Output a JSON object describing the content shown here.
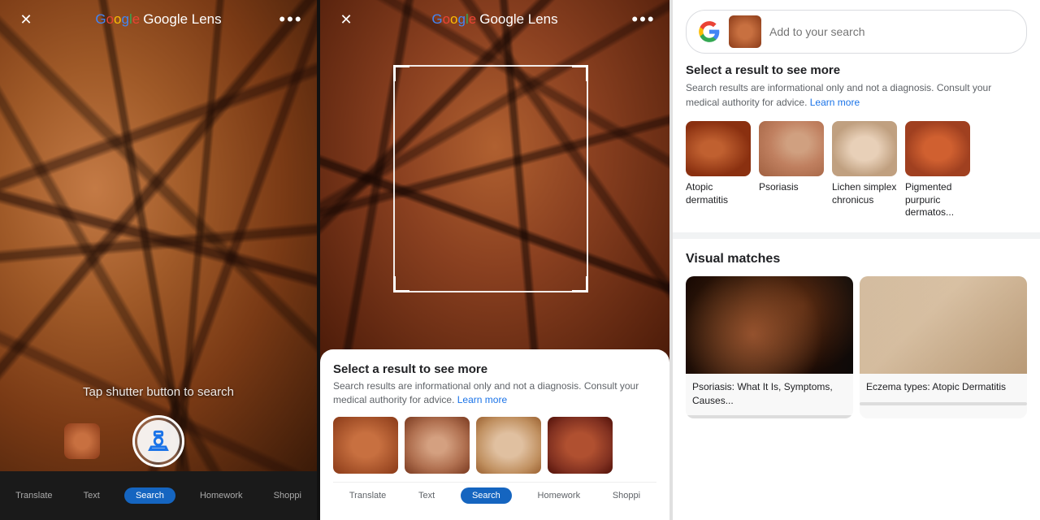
{
  "panel1": {
    "title": "Google Lens",
    "tap_hint": "Tap shutter button to search",
    "tabs": [
      {
        "label": "Translate",
        "active": false
      },
      {
        "label": "Text",
        "active": false
      },
      {
        "label": "Search",
        "active": true
      },
      {
        "label": "Homework",
        "active": false
      },
      {
        "label": "Shoppi",
        "active": false
      }
    ]
  },
  "panel2": {
    "title": "Google Lens",
    "bottom_sheet": {
      "title": "Select a result to see more",
      "desc": "Search results are informational only and not a diagnosis. Consult your medical authority for advice.",
      "learn_more": "Learn more"
    },
    "tabs": [
      {
        "label": "Translate",
        "active": false
      },
      {
        "label": "Text",
        "active": false
      },
      {
        "label": "Search",
        "active": true
      },
      {
        "label": "Homework",
        "active": false
      },
      {
        "label": "Shoppi",
        "active": false
      }
    ]
  },
  "panel3": {
    "search_placeholder": "Add to your search",
    "select_section": {
      "title": "Select a result to see more",
      "desc": "Search results are informational only and not a diagnosis. Consult your medical authority for advice.",
      "learn_more": "Learn more"
    },
    "conditions": [
      {
        "label": "Atopic dermatitis"
      },
      {
        "label": "Psoriasis"
      },
      {
        "label": "Lichen simplex chronicus"
      },
      {
        "label": "Pigmented purpuric dermatos..."
      }
    ],
    "visual_matches": {
      "title": "Visual matches",
      "items": [
        {
          "caption": "Psoriasis: What It Is, Symptoms, Causes..."
        },
        {
          "caption": "Eczema types: Atopic Dermatitis"
        }
      ]
    }
  },
  "icons": {
    "close": "✕",
    "flash_off": "⚡",
    "more": "⋯",
    "search_circle": "🔍",
    "gallery": "🖼"
  }
}
